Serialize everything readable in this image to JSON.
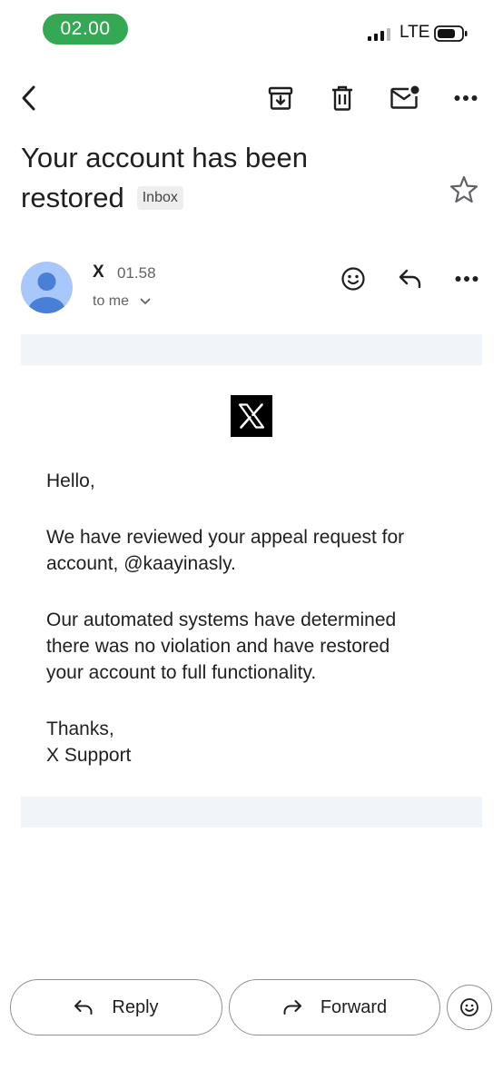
{
  "status_bar": {
    "time": "02.00",
    "network": "LTE",
    "time_pill_color": "#34a853"
  },
  "toolbar": {
    "icons": [
      "back-arrow-icon",
      "archive-icon",
      "trash-icon",
      "mark-unread-icon",
      "more-vert-icon"
    ]
  },
  "email": {
    "subject_line1": "Your account has been",
    "subject_line2": "restored",
    "label": "Inbox",
    "sender_name": "X",
    "time": "01.58",
    "recipient": "to me",
    "body": {
      "greeting": "Hello,",
      "paragraph1_line1": "We have reviewed your appeal request for",
      "paragraph1_line2": "account, @kaayinasly.",
      "paragraph2_line1": "Our automated systems have determined",
      "paragraph2_line2": "there was no violation and have restored",
      "paragraph2_line3": "your account to full functionality.",
      "signoff": "Thanks,",
      "signature": "X Support"
    }
  },
  "actions": {
    "reply_label": "Reply",
    "forward_label": "Forward"
  },
  "colors": {
    "avatar_bg": "#a8c7fa",
    "avatar_fg": "#4a7fd8",
    "band": "#f1f4f9"
  }
}
